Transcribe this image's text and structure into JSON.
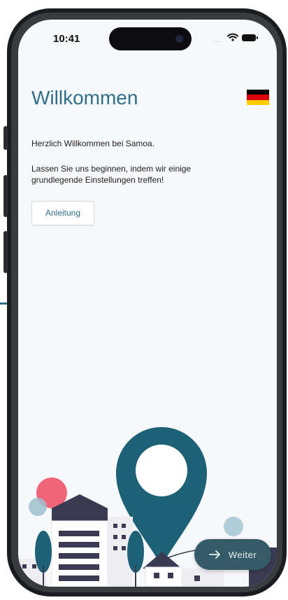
{
  "status_bar": {
    "time": "10:41",
    "signal": "....",
    "wifi_icon": "wifi-icon",
    "battery_icon": "battery-icon"
  },
  "header": {
    "title": "Willkommen",
    "language_flag": "german-flag-icon"
  },
  "content": {
    "greeting": "Herzlich Willkommen bei Samoa.",
    "instructions": "Lassen Sie uns beginnen, indem wir einige grundlegende Einstellungen treffen!",
    "guide_button": "Anleitung"
  },
  "footer": {
    "next_button": "Weiter",
    "next_icon": "arrow-right-icon"
  },
  "colors": {
    "accent": "#2f6f8c",
    "pin": "#1d6177",
    "button": "#355b68",
    "pink": "#f06478",
    "light_blue": "#9cc0cf"
  }
}
